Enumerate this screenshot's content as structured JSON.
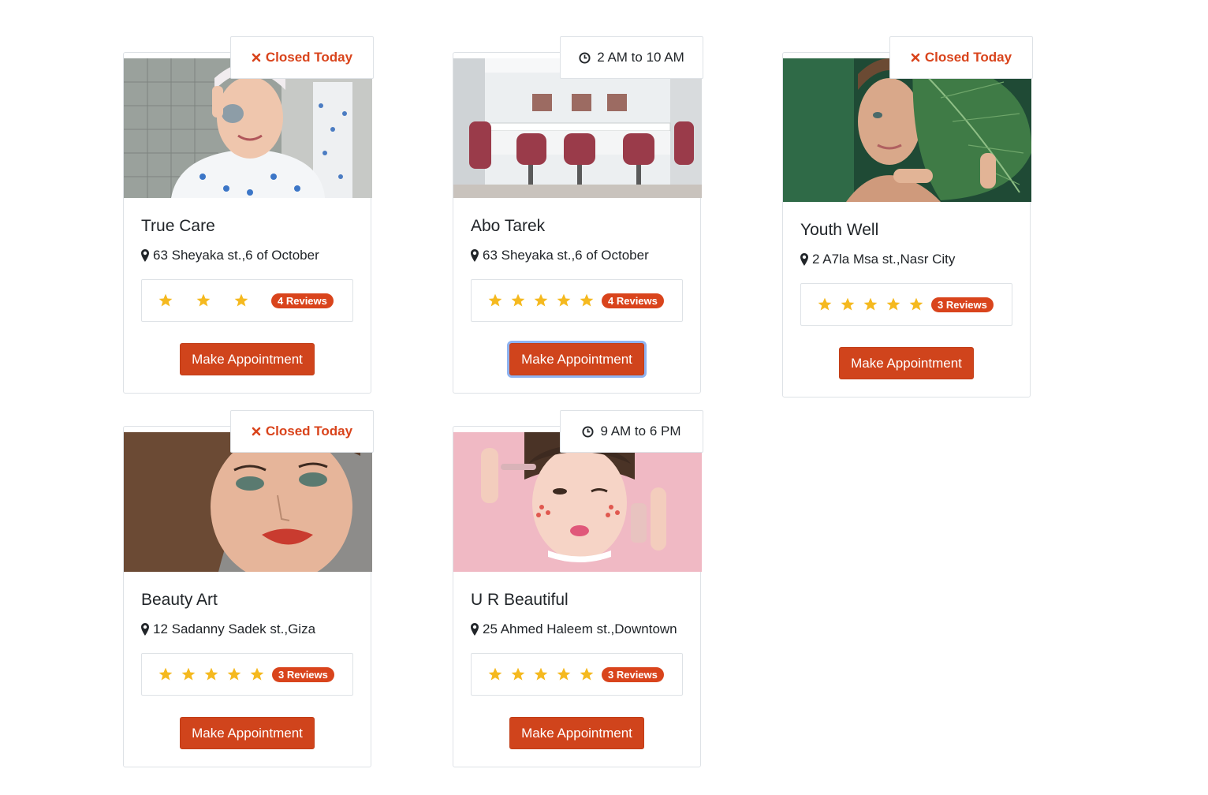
{
  "cards": [
    {
      "name": "True Care",
      "status": "Closed Today",
      "status_type": "closed",
      "status_icon": "close-icon",
      "address": "63 Sheyaka st.,6 of October",
      "stars": 3,
      "reviews": "4 Reviews",
      "button": "Make Appointment",
      "image": "woman-with-face-mask-in-bathroom"
    },
    {
      "name": "Abo Tarek",
      "status": "2 AM to 10 AM",
      "status_type": "open",
      "status_icon": "clock-icon",
      "address": "63 Sheyaka st.,6 of October",
      "stars": 5,
      "reviews": "4 Reviews",
      "button": "Make Appointment",
      "image": "salon-interior-with-chairs"
    },
    {
      "name": "Youth Well",
      "status": "Closed Today",
      "status_type": "closed",
      "status_icon": "close-icon",
      "address": "2 A7la Msa st.,Nasr City",
      "stars": 5,
      "reviews": "3 Reviews",
      "button": "Make Appointment",
      "image": "woman-with-green-leaf"
    },
    {
      "name": "Beauty Art",
      "status": "Closed Today",
      "status_type": "closed",
      "status_icon": "close-icon",
      "address": "12 Sadanny Sadek st.,Giza",
      "stars": 5,
      "reviews": "3 Reviews",
      "button": "Make Appointment",
      "image": "woman-with-red-lipstick"
    },
    {
      "name": "U R Beautiful",
      "status": "9 AM to 6 PM",
      "status_type": "open",
      "status_icon": "clock-icon",
      "address": "25 Ahmed Haleem st.,Downtown",
      "stars": 5,
      "reviews": "3 Reviews",
      "button": "Make Appointment",
      "image": "woman-applying-makeup-pink-background"
    }
  ],
  "colors": {
    "accent": "#d0441c",
    "closed_text": "#d9441c",
    "star": "#f5b91f",
    "border": "#dee2e6"
  }
}
